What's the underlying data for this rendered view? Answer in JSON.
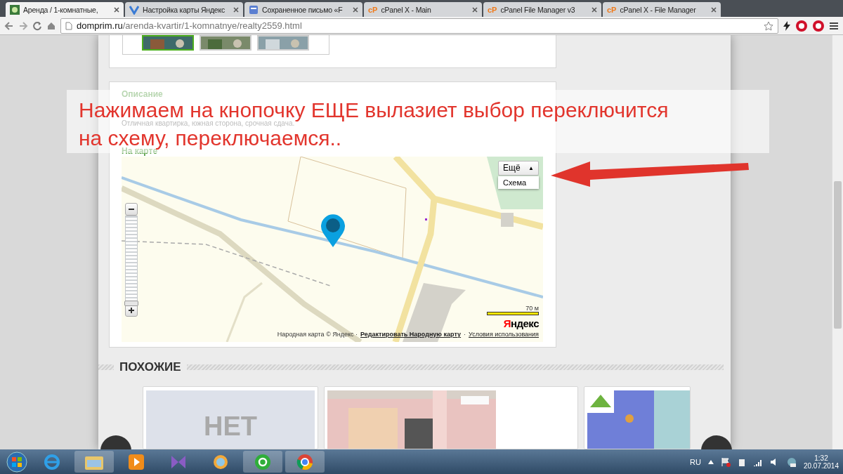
{
  "browser": {
    "tabs": [
      {
        "title": "Аренда / 1-комнатные,",
        "selected": true,
        "kind": "site"
      },
      {
        "title": "Настройка карты Яндекс",
        "selected": false,
        "kind": "map"
      },
      {
        "title": "Сохраненное письмо «F",
        "selected": false,
        "kind": "doc"
      },
      {
        "title": "cPanel X - Main",
        "selected": false,
        "kind": "cpanel",
        "icon_text": "cP"
      },
      {
        "title": "cPanel File Manager v3",
        "selected": false,
        "kind": "cpanel",
        "icon_text": "cP"
      },
      {
        "title": "cPanel X - File Manager",
        "selected": false,
        "kind": "cpanel",
        "icon_text": "cP"
      }
    ],
    "address": {
      "domain": "domprim.ru",
      "path": "/arenda-kvartir/1-komnatnye/realty2559.html"
    }
  },
  "listing": {
    "description_heading": "Описание",
    "description": "Отличная квартирка, южная сторона, срочная сдача.",
    "map_heading": "На карте",
    "map": {
      "layers_button": "Ещё",
      "layers_caret": "▲",
      "menu_items": [
        "Схема"
      ],
      "zoom_slider": {
        "level": 0.06
      },
      "scale": "70 м",
      "logo_first": "Я",
      "logo_rest": "ндекс",
      "credits": "Народная карта © Яндекс ·",
      "edit_link": "Редактировать Народную карту",
      "separator": "·",
      "terms_link": "Условия использования"
    }
  },
  "annotation_lines": [
    "Нажимаем на кнопочку ЕЩЕ вылазиет выбор переключится",
    "на схему, переключаемся.."
  ],
  "similar": {
    "title": "ПОХОЖИЕ",
    "cards": [
      {
        "kind": "placeholder",
        "text": "НЕТ"
      },
      {
        "kind": "picture"
      },
      {
        "kind": "picture"
      }
    ]
  },
  "taskbar": {
    "language": "RU",
    "time": "1:32",
    "date": "20.07.2014"
  }
}
